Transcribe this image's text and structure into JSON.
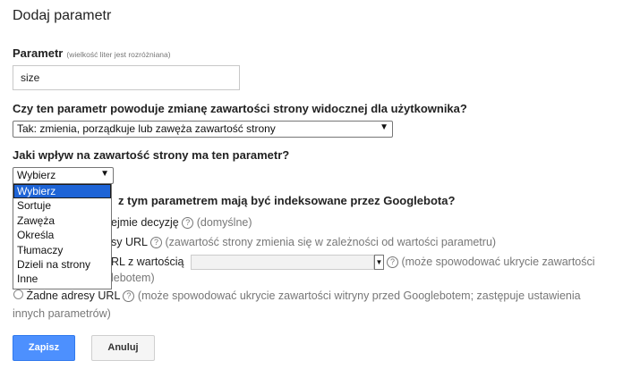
{
  "dialog": {
    "title": "Dodaj parametr",
    "param_label": "Parametr",
    "param_hint": "(wielkość liter jest rozróżniana)",
    "param_value": "size",
    "q1": "Czy ten parametr powoduje zmianę zawartości strony widocznej dla użytkownika?",
    "q1_selected": "Tak: zmienia, porządkuje lub zawęża zawartość strony",
    "q2": "Jaki wpływ na zawartość strony ma ten parametr?",
    "q2_selected": "Wybierz",
    "q2_options": [
      "Wybierz",
      "Sortuje",
      "Zawęża",
      "Określa",
      "Tłumaczy",
      "Dzieli na strony",
      "Inne"
    ],
    "q3_visible": "z tym parametrem mają być indeksowane przez Googlebota?",
    "opt1_text": "ejmie decyzję",
    "opt1_note": "(domyślne)",
    "opt2_text": "sy URL",
    "opt2_note": "(zawartość strony zmienia się w zależności od wartości parametru)",
    "opt3_text": "RL z wartością",
    "opt3_note": "(może spowodować ukrycie zawartości",
    "opt3_note_cont": "lebotem)",
    "opt4_text": "Żadne adresy URL",
    "opt4_note": "(może spowodować ukrycie zawartości witryny przed Googlebotem; zastępuje ustawienia",
    "opt4_note_cont": "innych parametrów)",
    "save": "Zapisz",
    "cancel": "Anuluj",
    "help_glyph": "?"
  },
  "colors": {
    "primary": "#4d90fe",
    "selection": "#1e64d6"
  }
}
